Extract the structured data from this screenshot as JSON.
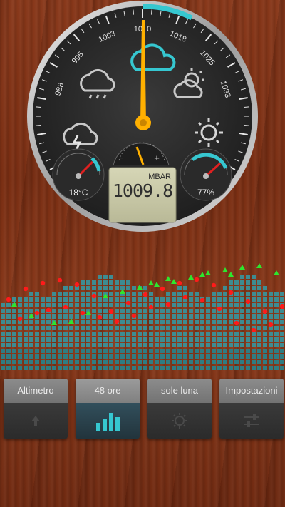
{
  "gauge": {
    "ticks": [
      "988",
      "995",
      "1003",
      "1010",
      "1018",
      "1025",
      "1033"
    ],
    "unit": "MBAR",
    "pressure": "1009.8",
    "temperature": "18°C",
    "humidity": "77%",
    "trend_minus": "−",
    "trend_plus": "+"
  },
  "tabs": [
    {
      "label": "Altimetro",
      "icon": "altimeter-arrow-icon",
      "active": false
    },
    {
      "label": "48 ore",
      "icon": "bar-chart-icon",
      "active": true
    },
    {
      "label": "sole luna",
      "icon": "sun-moon-icon",
      "active": false
    },
    {
      "label": "Impostazioni",
      "icon": "sliders-icon",
      "active": false
    }
  ],
  "colors": {
    "bar": "#3d8c92",
    "green": "#2ee62e",
    "red": "#ff1a1a",
    "needle": "#ffb000",
    "lcd": "#c9c9a6",
    "accent": "#36c7d0"
  }
}
